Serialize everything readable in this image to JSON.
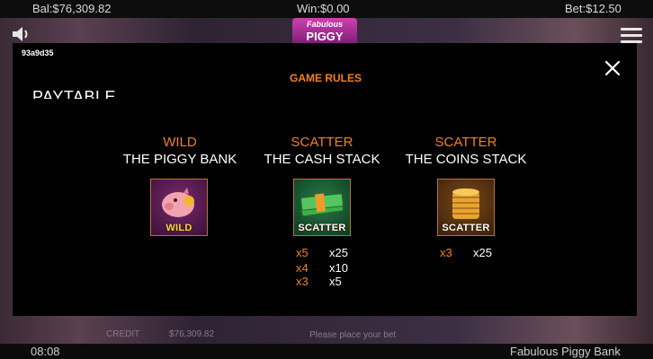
{
  "topbar": {
    "balance": "Bal:$76,309.82",
    "win": "Win:$0.00",
    "bet": "Bet:$12.50"
  },
  "logo": {
    "line1": "Fabulous",
    "line2": "PIGGY"
  },
  "session_id": "93a9d35",
  "rules": {
    "title": "GAME RULES",
    "section": "PAYTABLE"
  },
  "symbols": [
    {
      "type": "WILD",
      "name": "THE PIGGY BANK",
      "tile_label": "WILD",
      "pays": []
    },
    {
      "type": "SCATTER",
      "name": "THE CASH STACK",
      "tile_label": "SCATTER",
      "pays": [
        {
          "count": "x5",
          "value": "x25"
        },
        {
          "count": "x4",
          "value": "x10"
        },
        {
          "count": "x3",
          "value": "x5"
        }
      ]
    },
    {
      "type": "SCATTER",
      "name": "THE COINS STACK",
      "tile_label": "SCATTER",
      "pays": [
        {
          "count": "x3",
          "value": "x25"
        }
      ]
    }
  ],
  "background_hud": {
    "credit_label": "CREDIT",
    "credit_value": "$76,309.82",
    "message": "Please place your bet"
  },
  "bottombar": {
    "time": "08:08",
    "game_name": "Fabulous Piggy Bank"
  },
  "colors": {
    "accent": "#f0821e",
    "overlay": "#000000"
  }
}
